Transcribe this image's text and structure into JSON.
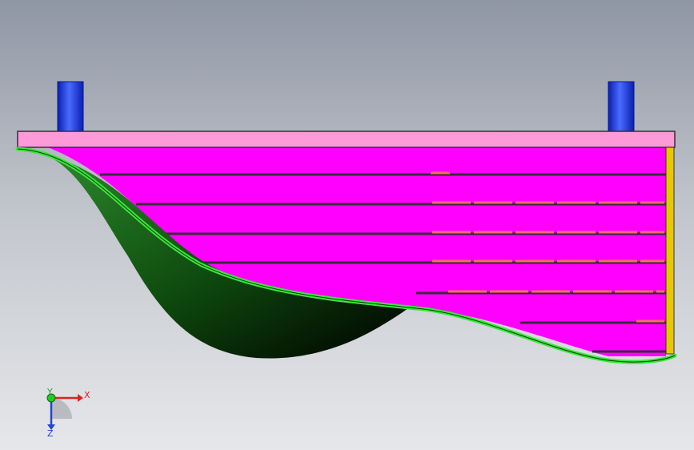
{
  "viewport": {
    "background_top": "#8f96a4",
    "background_bottom": "#e6e7ea"
  },
  "model": {
    "parts": [
      {
        "name": "top-plate",
        "color": "#ff9ad9"
      },
      {
        "name": "slat-stack",
        "color": "#ff00ff",
        "slat_count": 7
      },
      {
        "name": "curved-shell",
        "color": "#1f6b1f",
        "edge_color": "#39e639"
      },
      {
        "name": "right-end-plate",
        "color": "#e6c800"
      },
      {
        "name": "left-post",
        "color": "#1133dd"
      },
      {
        "name": "right-post",
        "color": "#1133dd"
      }
    ]
  },
  "triad": {
    "x_label": "X",
    "y_label": "Y",
    "z_label": "Z",
    "x_color": "#dd2222",
    "y_color": "#22aa22",
    "z_color": "#2244dd"
  }
}
